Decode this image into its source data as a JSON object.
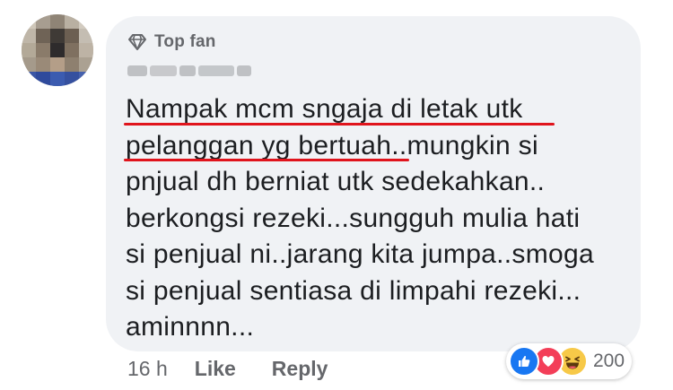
{
  "comment": {
    "badge": "Top fan",
    "lines": [
      "Nampak mcm sngaja di letak utk",
      "pelanggan yg bertuah..mungkin si",
      "pnjual dh berniat utk sedekahkan..",
      "berkongsi rezeki...sungguh mulia hati",
      "si penjual ni..jarang kita jumpa..smoga",
      "si penjual sentiasa di limpahi rezeki...",
      "aminnnn..."
    ],
    "timestamp": "16 h",
    "like_label": "Like",
    "reply_label": "Reply",
    "reaction_count": "200"
  },
  "icons": {
    "badge": "diamond-icon",
    "reactions": [
      "like-icon",
      "love-icon",
      "haha-icon"
    ]
  },
  "colors": {
    "bubble_bg": "#f0f2f5",
    "text": "#1c1e21",
    "meta_text": "#65676b",
    "highlight_underline": "#e0141c",
    "like": "#1877f2",
    "love": "#f33e58",
    "haha": "#f7c948"
  }
}
